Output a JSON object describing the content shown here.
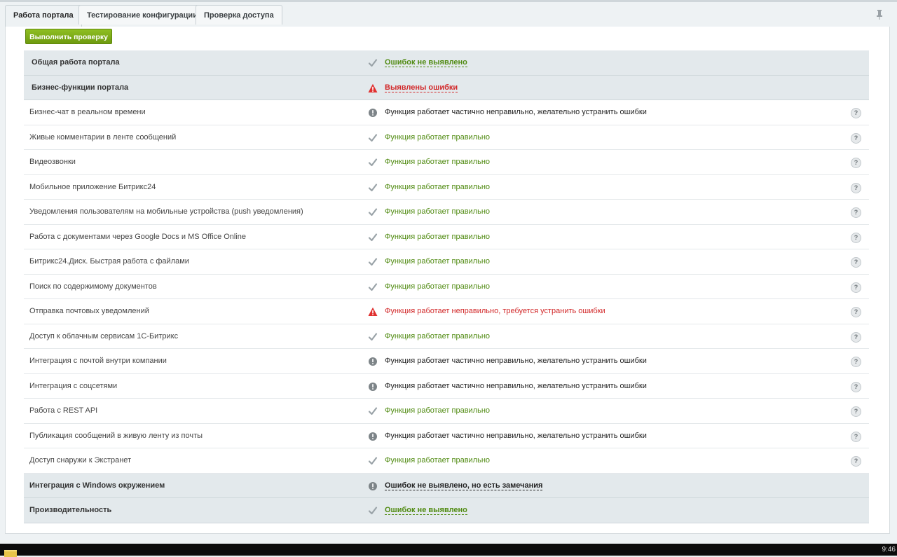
{
  "tabs": [
    {
      "label": "Работа портала",
      "active": true
    },
    {
      "label": "Тестирование конфигурации",
      "active": false
    },
    {
      "label": "Проверка доступа",
      "active": false
    }
  ],
  "run_button": "Выполнить проверку",
  "colors": {
    "ok": "#4f8a10",
    "error": "#d2292a",
    "warn": "#222222",
    "accent": "#7aab14"
  },
  "rows": [
    {
      "type": "group",
      "name": "Общая работа портала",
      "status": "ok",
      "text": "Ошибок не выявлено"
    },
    {
      "type": "group",
      "name": "Бизнес-функции портала",
      "status": "error",
      "text": "Выявлены ошибки"
    },
    {
      "type": "item",
      "name": "Бизнес-чат в реальном времени",
      "status": "warn",
      "text": "Функция работает частично неправильно, желательно устранить ошибки"
    },
    {
      "type": "item",
      "name": "Живые комментарии в ленте сообщений",
      "status": "ok",
      "text": "Функция работает правильно"
    },
    {
      "type": "item",
      "name": "Видеозвонки",
      "status": "ok",
      "text": "Функция работает правильно"
    },
    {
      "type": "item",
      "name": "Мобильное приложение Битрикс24",
      "status": "ok",
      "text": "Функция работает правильно"
    },
    {
      "type": "item",
      "name": "Уведомления пользователям на мобильные устройства (push уведомления)",
      "status": "ok",
      "text": "Функция работает правильно"
    },
    {
      "type": "item",
      "name": "Работа с документами через Google Docs и MS Office Online",
      "status": "ok",
      "text": "Функция работает правильно"
    },
    {
      "type": "item",
      "name": "Битрикс24.Диск. Быстрая работа с файлами",
      "status": "ok",
      "text": "Функция работает правильно"
    },
    {
      "type": "item",
      "name": "Поиск по содержимому документов",
      "status": "ok",
      "text": "Функция работает правильно"
    },
    {
      "type": "item",
      "name": "Отправка почтовых уведомлений",
      "status": "error",
      "text": "Функция работает неправильно, требуется устранить ошибки"
    },
    {
      "type": "item",
      "name": "Доступ к облачным сервисам 1С-Битрикс",
      "status": "ok",
      "text": "Функция работает правильно"
    },
    {
      "type": "item",
      "name": "Интеграция с почтой внутри компании",
      "status": "warn",
      "text": "Функция работает частично неправильно, желательно устранить ошибки"
    },
    {
      "type": "item",
      "name": "Интеграция с соцсетями",
      "status": "warn",
      "text": "Функция работает частично неправильно, желательно устранить ошибки"
    },
    {
      "type": "item",
      "name": "Работа с REST API",
      "status": "ok",
      "text": "Функция работает правильно"
    },
    {
      "type": "item",
      "name": "Публикация сообщений в живую ленту из почты",
      "status": "warn",
      "text": "Функция работает частично неправильно, желательно устранить ошибки"
    },
    {
      "type": "item",
      "name": "Доступ снаружи к Экстранет",
      "status": "ok",
      "text": "Функция работает правильно"
    },
    {
      "type": "group",
      "name": "Интеграция с Windows окружением",
      "status": "warn",
      "text": "Ошибок не выявлено, но есть замечания"
    },
    {
      "type": "group",
      "name": "Производительность",
      "status": "ok",
      "text": "Ошибок не выявлено"
    }
  ],
  "help_label": "?",
  "taskbar": {
    "clock": "9:46"
  }
}
